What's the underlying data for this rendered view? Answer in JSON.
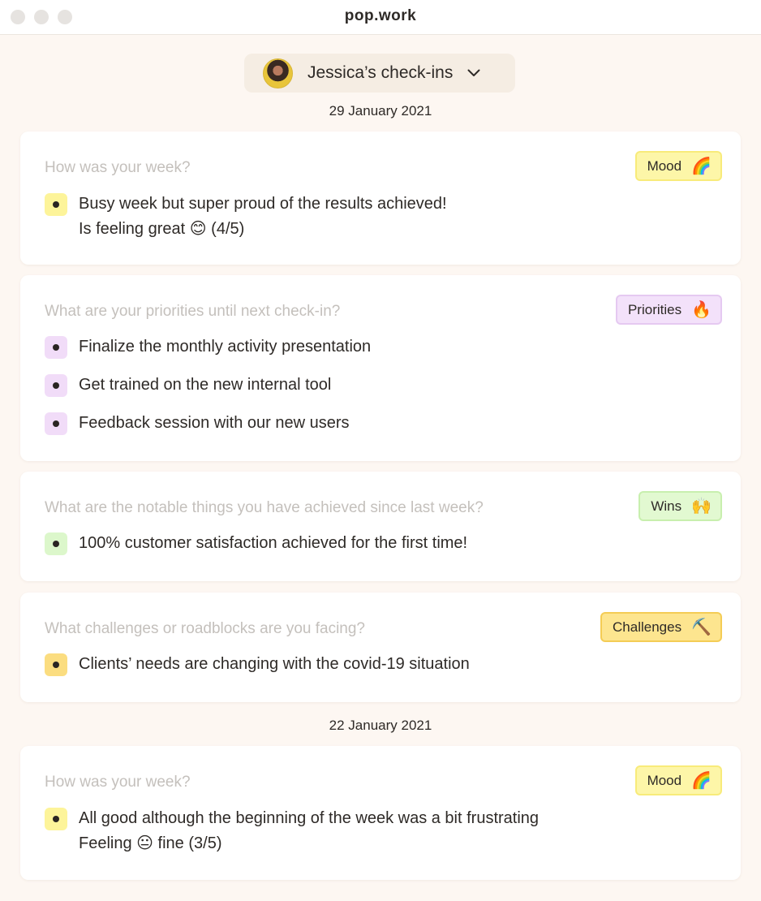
{
  "window": {
    "title": "pop.work"
  },
  "selector": {
    "label": "Jessica’s check-ins"
  },
  "groups": [
    {
      "date": "29 January 2021",
      "cards": [
        {
          "question": "How was your week?",
          "tag": {
            "label": "Mood",
            "icon": "🌈",
            "icon_name": "rainbow-icon"
          },
          "items": [
            {
              "lines": [
                "Busy week but super proud of the results achieved!",
                "Is feeling great 😊 (4/5)"
              ]
            }
          ]
        },
        {
          "question": "What are your priorities until next check-in?",
          "tag": {
            "label": "Priorities",
            "icon": "🔥",
            "icon_name": "fire-icon"
          },
          "items": [
            {
              "lines": [
                "Finalize the monthly activity presentation"
              ]
            },
            {
              "lines": [
                "Get trained on the new internal tool"
              ]
            },
            {
              "lines": [
                "Feedback session with our new users"
              ]
            }
          ]
        },
        {
          "question": "What are the notable things you have achieved since last week?",
          "tag": {
            "label": "Wins",
            "icon": "🙌",
            "icon_name": "raised-hands-icon"
          },
          "items": [
            {
              "lines": [
                "100% customer satisfaction achieved for the first time!"
              ]
            }
          ]
        },
        {
          "question": "What challenges or roadblocks are you facing?",
          "tag": {
            "label": "Challenges",
            "icon": "⛏️",
            "icon_name": "pick-icon"
          },
          "items": [
            {
              "lines": [
                "Clients’ needs are changing with the covid-19 situation"
              ]
            }
          ]
        }
      ]
    },
    {
      "date": "22 January 2021",
      "cards": [
        {
          "question": "How was your week?",
          "tag": {
            "label": "Mood",
            "icon": "🌈",
            "icon_name": "rainbow-icon"
          },
          "items": [
            {
              "lines": [
                "All good although the beginning of the week was a bit frustrating",
                "Feeling 😐 fine (3/5)"
              ]
            }
          ]
        }
      ]
    }
  ],
  "colors": {
    "background": "#fdf7f2",
    "mood": "#fdf6a8",
    "priorities": "#f3e1fa",
    "wins": "#e2f9d1",
    "challenges": "#fde58f"
  }
}
